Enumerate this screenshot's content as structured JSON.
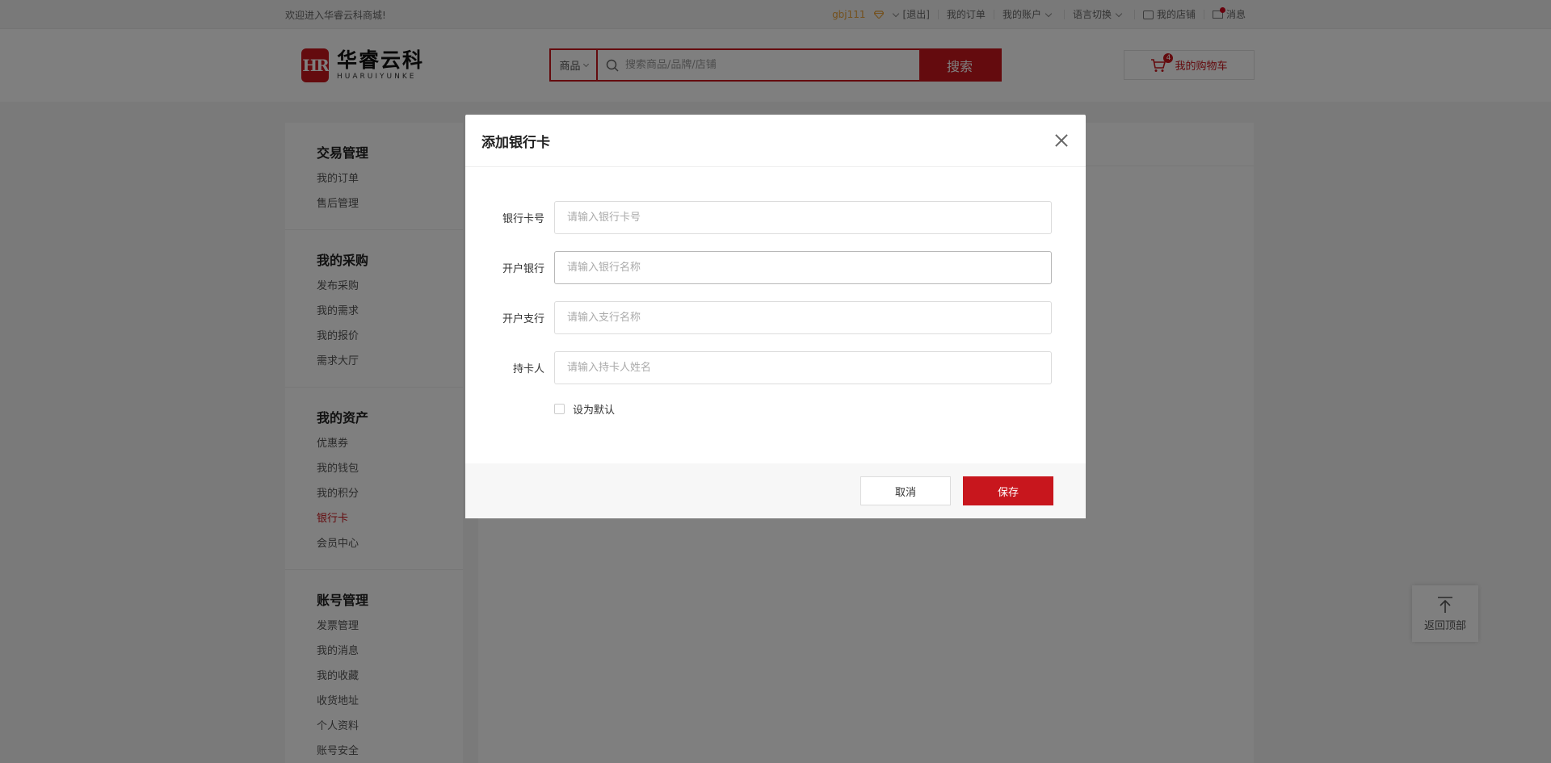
{
  "topbar": {
    "welcome": "欢迎进入华睿云科商城!",
    "username": "gbj111",
    "logout": "[退出]",
    "my_orders": "我的订单",
    "my_account": "我的账户",
    "language": "语言切换",
    "my_store": "我的店铺",
    "messages": "消息"
  },
  "header": {
    "logo_mark": "HR",
    "logo_cn": "华睿云科",
    "logo_en": "HUARUIYUNKE",
    "search_category": "商品",
    "search_placeholder": "搜索商品/品牌/店铺",
    "search_button": "搜索",
    "cart_label": "我的购物车",
    "cart_count": "4"
  },
  "sidebar": {
    "groups": [
      {
        "title": "交易管理",
        "items": [
          "我的订单",
          "售后管理"
        ]
      },
      {
        "title": "我的采购",
        "items": [
          "发布采购",
          "我的需求",
          "我的报价",
          "需求大厅"
        ]
      },
      {
        "title": "我的资产",
        "items": [
          "优惠券",
          "我的钱包",
          "我的积分",
          "银行卡",
          "会员中心"
        ]
      },
      {
        "title": "账号管理",
        "items": [
          "发票管理",
          "我的消息",
          "我的收藏",
          "收货地址",
          "个人资料",
          "账号安全"
        ]
      }
    ]
  },
  "back_to_top": "返回顶部",
  "modal": {
    "title": "添加银行卡",
    "fields": [
      {
        "label": "银行卡号",
        "placeholder": "请输入银行卡号",
        "value": ""
      },
      {
        "label": "开户银行",
        "placeholder": "请输入银行名称",
        "value": ""
      },
      {
        "label": "开户支行",
        "placeholder": "请输入支行名称",
        "value": ""
      },
      {
        "label": "持卡人",
        "placeholder": "请输入持卡人姓名",
        "value": ""
      }
    ],
    "default_checkbox": "设为默认",
    "cancel": "取消",
    "save": "保存"
  },
  "colors": {
    "brand": "#c8161d",
    "user": "#e8a33c"
  }
}
